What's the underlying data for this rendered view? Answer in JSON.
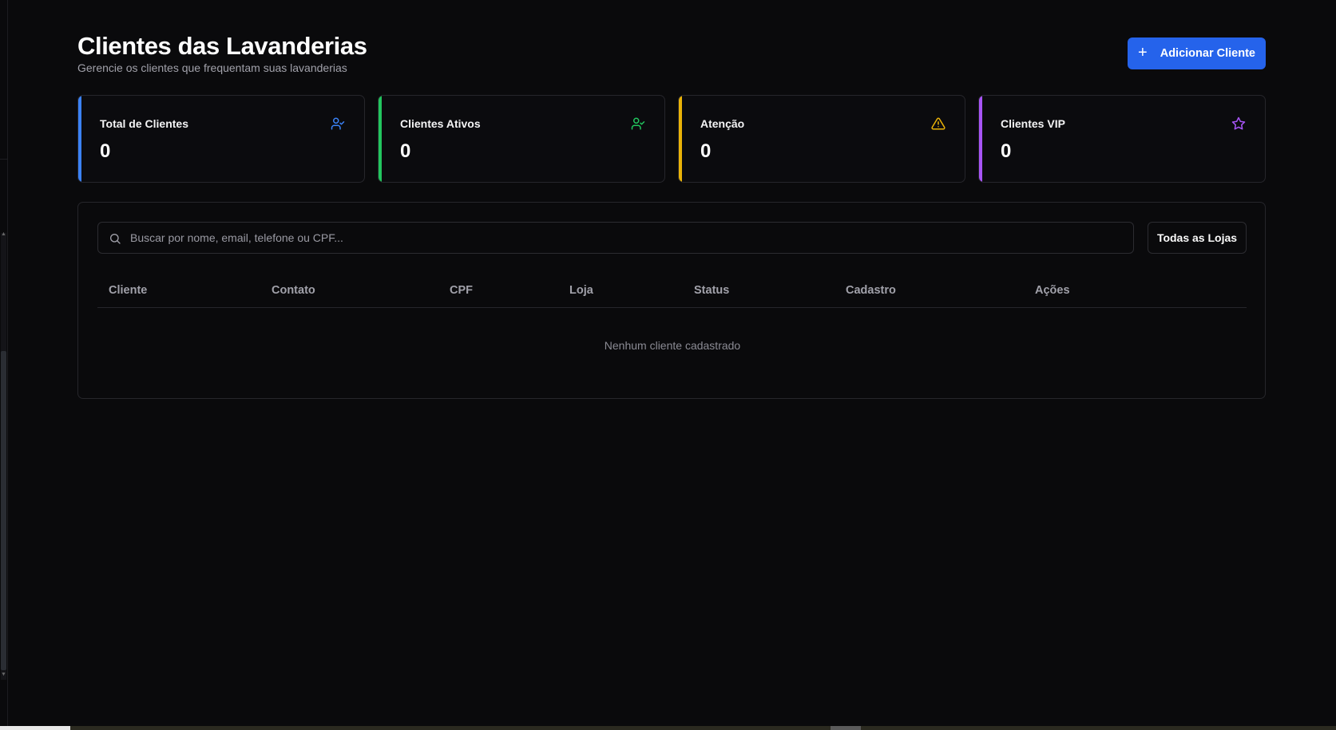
{
  "header": {
    "title": "Clientes das Lavanderias",
    "subtitle": "Gerencie os clientes que frequentam suas lavanderias",
    "add_button_label": "Adicionar Cliente"
  },
  "stats": [
    {
      "label": "Total de Clientes",
      "value": "0",
      "color": "#3b82f6",
      "icon": "user-check-icon"
    },
    {
      "label": "Clientes Ativos",
      "value": "0",
      "color": "#22c55e",
      "icon": "user-check-icon"
    },
    {
      "label": "Atenção",
      "value": "0",
      "color": "#eab308",
      "icon": "warning-icon"
    },
    {
      "label": "Clientes VIP",
      "value": "0",
      "color": "#a855f7",
      "icon": "star-icon"
    }
  ],
  "search": {
    "placeholder": "Buscar por nome, email, telefone ou CPF...",
    "value": ""
  },
  "filter": {
    "selected": "Todas as Lojas"
  },
  "table": {
    "columns": [
      "Cliente",
      "Contato",
      "CPF",
      "Loja",
      "Status",
      "Cadastro",
      "Ações"
    ],
    "rows": [],
    "empty_message": "Nenhum cliente cadastrado"
  },
  "colors": {
    "background": "#0a0a0c",
    "primary": "#2563eb",
    "border": "#26262b",
    "muted_text": "#a1a1aa"
  }
}
